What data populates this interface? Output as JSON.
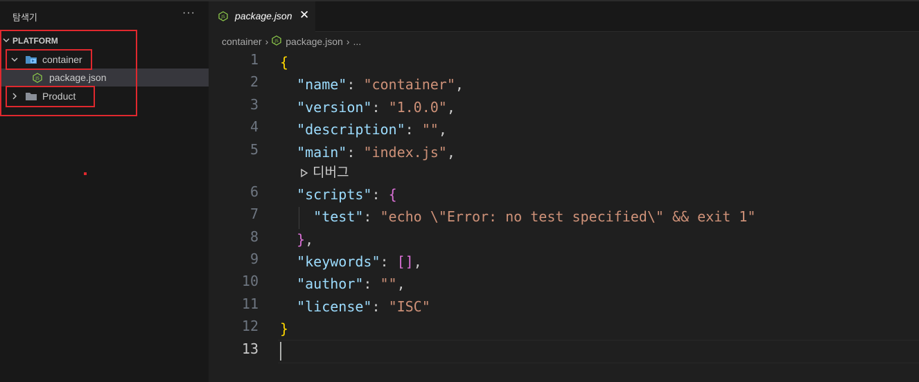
{
  "sidebar": {
    "title": "탐색기",
    "more": "···",
    "root": "PLATFORM",
    "items": [
      {
        "label": "container",
        "icon": "folder-open-icon"
      },
      {
        "label": "package.json",
        "icon": "nodejs-icon"
      },
      {
        "label": "Product",
        "icon": "folder-icon"
      }
    ]
  },
  "tab": {
    "label": "package.json",
    "close": "✕"
  },
  "breadcrumb": {
    "folder": "container",
    "file": "package.json",
    "more": "..."
  },
  "codelens": "디버그",
  "lines": [
    "1",
    "2",
    "3",
    "4",
    "5",
    "6",
    "7",
    "8",
    "9",
    "10",
    "11",
    "12",
    "13"
  ],
  "colors": {
    "key": "#9cdcfe",
    "string": "#ce9178",
    "brace": "#ffd700",
    "bracket": "#da70d6",
    "annotation": "#e0282e"
  }
}
